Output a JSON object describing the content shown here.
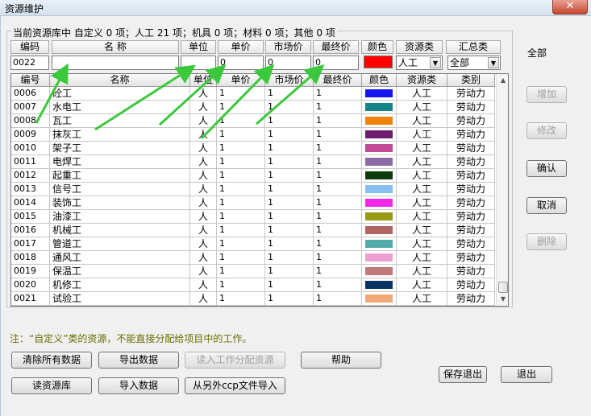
{
  "window": {
    "title": "资源维护",
    "close_label": "✕"
  },
  "summary": "当前资源库中 自定义 0 项；人工 21 项；机具 0 项；材料 0 项；其他 0 项",
  "scope_label": "全部",
  "editor": {
    "headers": {
      "code": "编码",
      "name": "名  称",
      "unit": "单位",
      "price": "单价",
      "market_price": "市场价",
      "final_price": "最终价",
      "color": "颜色",
      "resource_type": "资源类",
      "summary_type": "汇总类"
    },
    "values": {
      "code": "0022",
      "name": "",
      "unit": "",
      "price": "0",
      "market_price": "0",
      "final_price": "0",
      "color": "#ff0000",
      "resource_type": "人工",
      "summary_type": "全部"
    }
  },
  "grid": {
    "columns": [
      "编号",
      "名称",
      "单位",
      "单价",
      "市场价",
      "最终价",
      "颜色",
      "资源类",
      "类别"
    ],
    "rows": [
      {
        "code": "0006",
        "name": "砼工",
        "unit": "人",
        "price": "1",
        "market": "1",
        "final": "1",
        "color": "#1414f0",
        "rtype": "人工",
        "cat": "劳动力"
      },
      {
        "code": "0007",
        "name": "水电工",
        "unit": "人",
        "price": "1",
        "market": "1",
        "final": "1",
        "color": "#14868a",
        "rtype": "人工",
        "cat": "劳动力"
      },
      {
        "code": "0008",
        "name": "瓦工",
        "unit": "人",
        "price": "1",
        "market": "1",
        "final": "1",
        "color": "#f0820a",
        "rtype": "人工",
        "cat": "劳动力"
      },
      {
        "code": "0009",
        "name": "抹灰工",
        "unit": "人",
        "price": "1",
        "market": "1",
        "final": "1",
        "color": "#6e1c6e",
        "rtype": "人工",
        "cat": "劳动力"
      },
      {
        "code": "0010",
        "name": "架子工",
        "unit": "人",
        "price": "1",
        "market": "1",
        "final": "1",
        "color": "#c04a96",
        "rtype": "人工",
        "cat": "劳动力"
      },
      {
        "code": "0011",
        "name": "电焊工",
        "unit": "人",
        "price": "1",
        "market": "1",
        "final": "1",
        "color": "#8c6ca6",
        "rtype": "人工",
        "cat": "劳动力"
      },
      {
        "code": "0012",
        "name": "起重工",
        "unit": "人",
        "price": "1",
        "market": "1",
        "final": "1",
        "color": "#0c3c0c",
        "rtype": "人工",
        "cat": "劳动力"
      },
      {
        "code": "0013",
        "name": "信号工",
        "unit": "人",
        "price": "1",
        "market": "1",
        "final": "1",
        "color": "#86bff0",
        "rtype": "人工",
        "cat": "劳动力"
      },
      {
        "code": "0014",
        "name": "装饰工",
        "unit": "人",
        "price": "1",
        "market": "1",
        "final": "1",
        "color": "#f028e8",
        "rtype": "人工",
        "cat": "劳动力"
      },
      {
        "code": "0015",
        "name": "油漆工",
        "unit": "人",
        "price": "1",
        "market": "1",
        "final": "1",
        "color": "#9a9a12",
        "rtype": "人工",
        "cat": "劳动力"
      },
      {
        "code": "0016",
        "name": "机械工",
        "unit": "人",
        "price": "1",
        "market": "1",
        "final": "1",
        "color": "#b06464",
        "rtype": "人工",
        "cat": "劳动力"
      },
      {
        "code": "0017",
        "name": "管道工",
        "unit": "人",
        "price": "1",
        "market": "1",
        "final": "1",
        "color": "#50aaaa",
        "rtype": "人工",
        "cat": "劳动力"
      },
      {
        "code": "0018",
        "name": "通风工",
        "unit": "人",
        "price": "1",
        "market": "1",
        "final": "1",
        "color": "#f0a0d0",
        "rtype": "人工",
        "cat": "劳动力"
      },
      {
        "code": "0019",
        "name": "保温工",
        "unit": "人",
        "price": "1",
        "market": "1",
        "final": "1",
        "color": "#c07878",
        "rtype": "人工",
        "cat": "劳动力"
      },
      {
        "code": "0020",
        "name": "机修工",
        "unit": "人",
        "price": "1",
        "market": "1",
        "final": "1",
        "color": "#0a3264",
        "rtype": "人工",
        "cat": "劳动力"
      },
      {
        "code": "0021",
        "name": "试验工",
        "unit": "人",
        "price": "1",
        "market": "1",
        "final": "1",
        "color": "#f0a878",
        "rtype": "人工",
        "cat": "劳动力"
      }
    ]
  },
  "side_buttons": {
    "add": "增加",
    "modify": "修改",
    "confirm": "确认",
    "cancel": "取消",
    "delete": "删除"
  },
  "note": "注：“自定义”类的资源，不能直接分配给项目中的工作。",
  "bottom_buttons": {
    "clear_all": "清除所有数据",
    "export": "导出数据",
    "read_work_alloc": "读入工作分配资源",
    "help": "帮助",
    "read_library": "读资源库",
    "import": "导入数据",
    "import_other": "从另外ccp文件导入",
    "save_exit": "保存退出",
    "exit": "退出"
  },
  "colors": {
    "arrow": "#3cc83c"
  }
}
